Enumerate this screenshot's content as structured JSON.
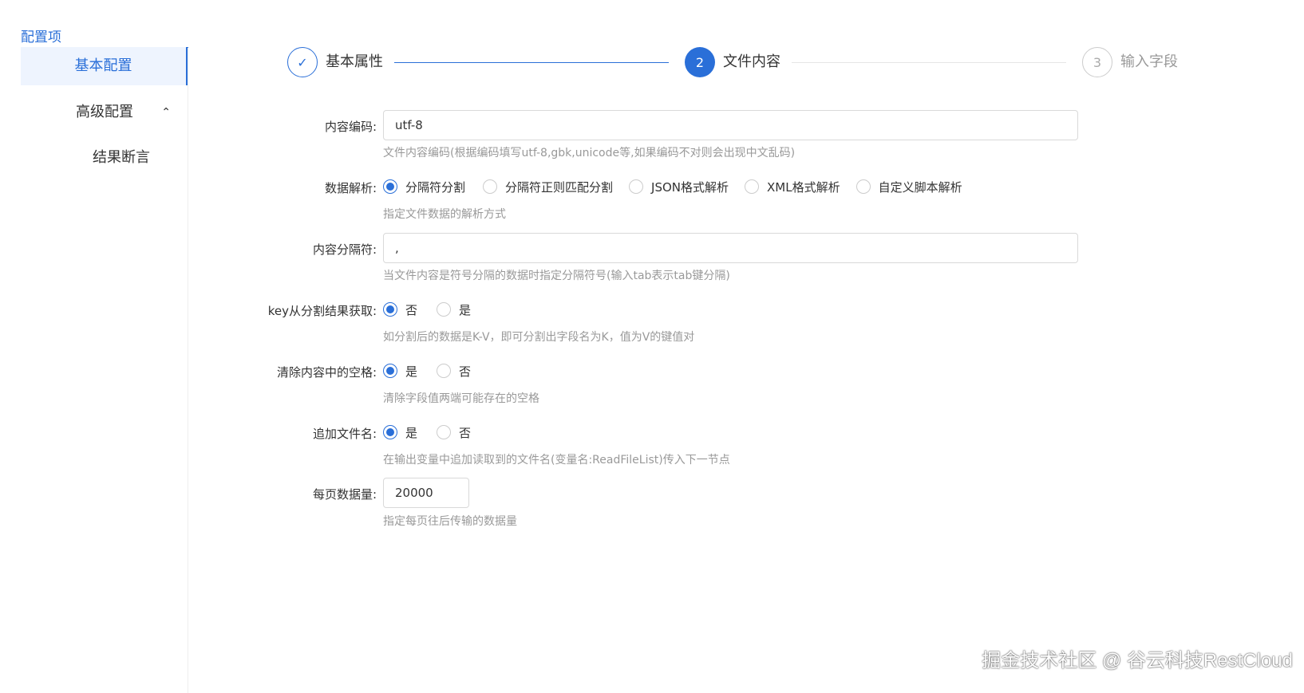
{
  "sidebar": {
    "title": "配置项",
    "items": [
      {
        "label": "基本配置",
        "active": true
      },
      {
        "label": "高级配置",
        "expanded": true,
        "caret": "⌃"
      },
      {
        "label": "结果断言"
      }
    ]
  },
  "steps": [
    {
      "label": "基本属性",
      "status": "done",
      "icon": "check-icon",
      "mark": "✓"
    },
    {
      "label": "文件内容",
      "status": "active",
      "number": "2"
    },
    {
      "label": "输入字段",
      "status": "wait",
      "number": "3"
    }
  ],
  "form": {
    "encoding": {
      "label": "内容编码:",
      "value": "utf-8",
      "hint": "文件内容编码(根据编码填写utf-8,gbk,unicode等,如果编码不对则会出现中文乱码)"
    },
    "parse": {
      "label": "数据解析:",
      "options": [
        "分隔符分割",
        "分隔符正则匹配分割",
        "JSON格式解析",
        "XML格式解析",
        "自定义脚本解析"
      ],
      "selected": "分隔符分割",
      "hint": "指定文件数据的解析方式"
    },
    "separator": {
      "label": "内容分隔符:",
      "value": ",",
      "hint": "当文件内容是符号分隔的数据时指定分隔符号(输入tab表示tab键分隔)"
    },
    "key_from_split": {
      "label": "key从分割结果获取:",
      "options": [
        "否",
        "是"
      ],
      "selected": "否",
      "hint": "如分割后的数据是K-V，即可分割出字段名为K，值为V的键值对"
    },
    "trim_spaces": {
      "label": "清除内容中的空格:",
      "options": [
        "是",
        "否"
      ],
      "selected": "是",
      "hint": "清除字段值两端可能存在的空格"
    },
    "append_filename": {
      "label": "追加文件名:",
      "options": [
        "是",
        "否"
      ],
      "selected": "是",
      "hint": "在输出变量中追加读取到的文件名(变量名:ReadFileList)传入下一节点"
    },
    "page_size": {
      "label": "每页数据量:",
      "value": "20000",
      "hint": "指定每页往后传输的数据量"
    }
  },
  "watermark": "掘金技术社区 @ 谷云科技RestCloud",
  "colors": {
    "accent": "#2a6fd8",
    "hint": "#999999",
    "border": "#d9d9d9"
  }
}
